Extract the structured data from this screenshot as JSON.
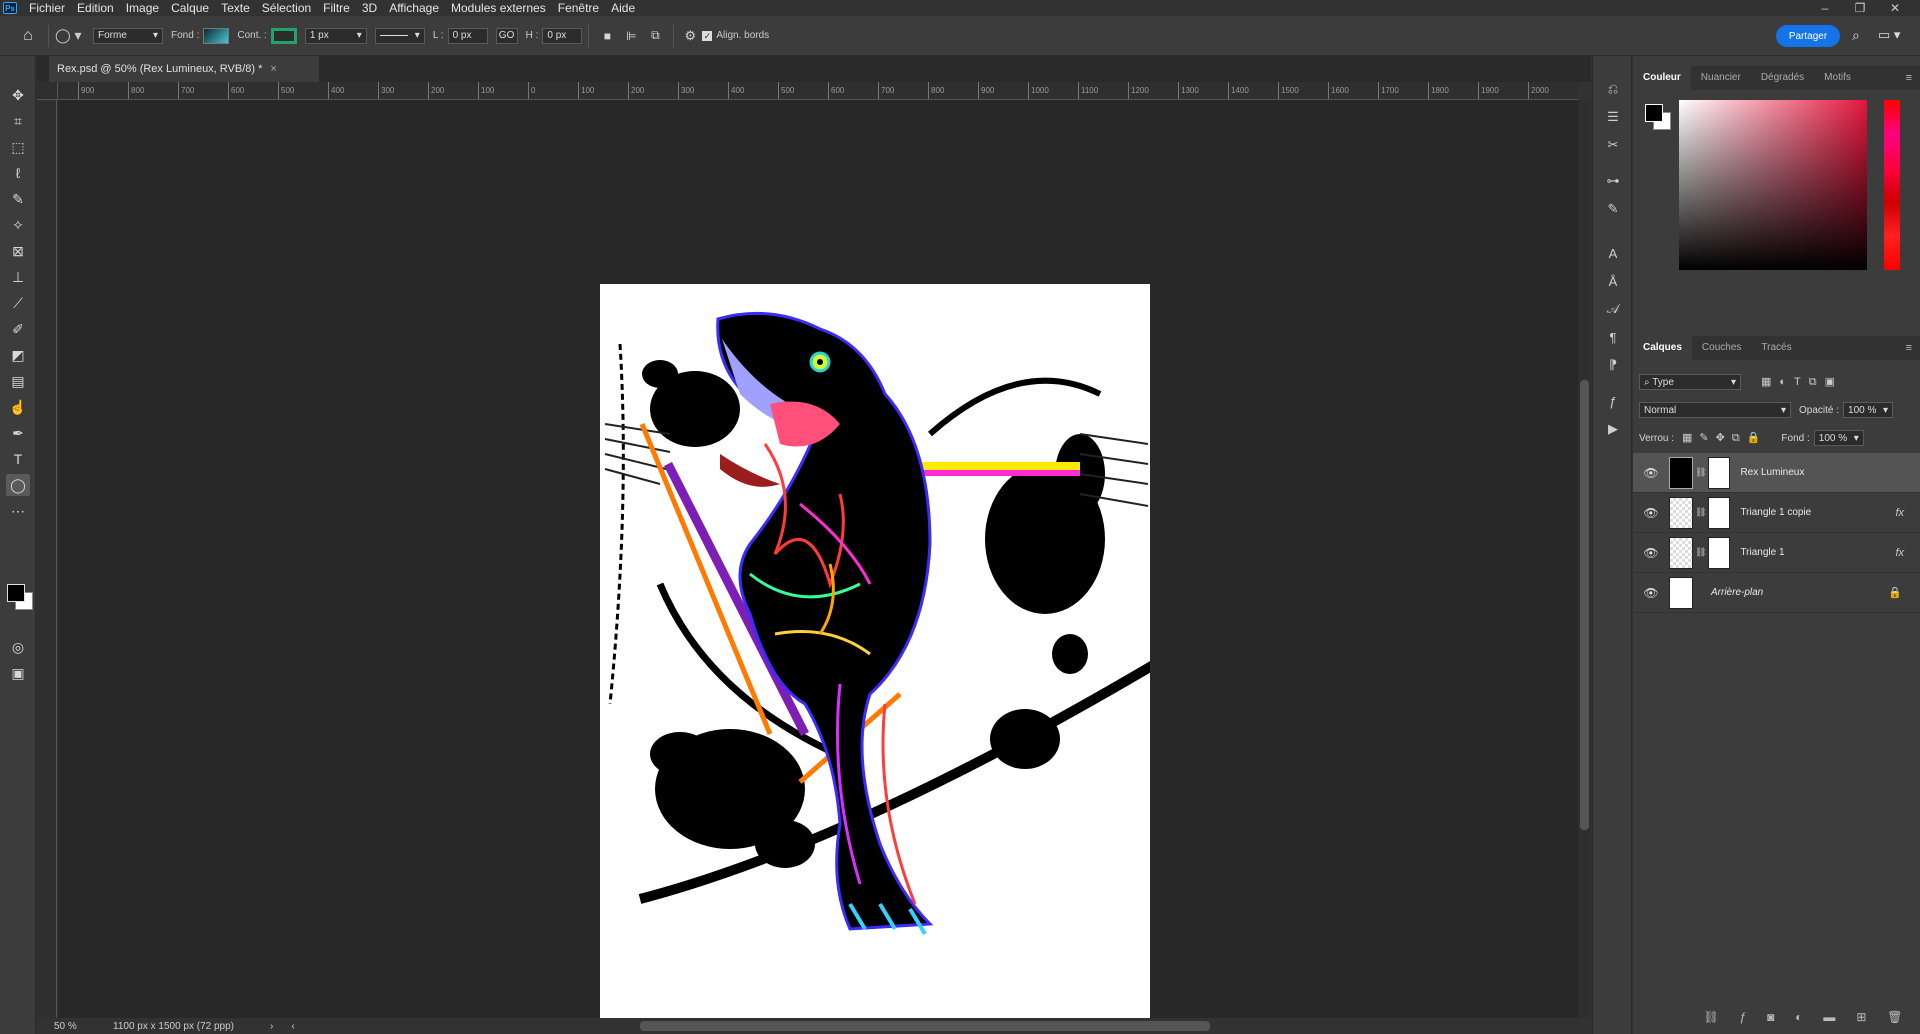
{
  "menu": [
    "Fichier",
    "Edition",
    "Image",
    "Calque",
    "Texte",
    "Sélection",
    "Filtre",
    "3D",
    "Affichage",
    "Modules externes",
    "Fenêtre",
    "Aide"
  ],
  "app_logo": "Ps",
  "window_controls": {
    "minimize": "–",
    "restore": "❐",
    "close": "✕"
  },
  "options": {
    "shape_mode": "Forme",
    "fill_label": "Fond :",
    "stroke_label": "Cont. :",
    "stroke_width": "1 px",
    "width_label": "L :",
    "width_value": "0 px",
    "link": "GO",
    "height_label": "H :",
    "height_value": "0 px",
    "align_edges": "Align. bords",
    "share": "Partager"
  },
  "document": {
    "tab_title": "Rex.psd @ 50% (Rex Lumineux, RVB/8) *",
    "tab_close": "×",
    "zoom": "50 %",
    "size_info": "1100 px x 1500 px (72 ppp)"
  },
  "ruler_h": [
    "900",
    "800",
    "700",
    "600",
    "500",
    "400",
    "300",
    "200",
    "100",
    "0",
    "100",
    "200",
    "300",
    "400",
    "500",
    "600",
    "700",
    "800",
    "900",
    "1000",
    "1100",
    "1200",
    "1300",
    "1400",
    "1500",
    "1600",
    "1700",
    "1800",
    "1900",
    "2000"
  ],
  "color_panel": {
    "tabs": [
      "Couleur",
      "Nuancier",
      "Dégradés",
      "Motifs"
    ],
    "fg": "#000000",
    "bg": "#ffffff",
    "hue": "#e4163c"
  },
  "layers_panel": {
    "tabs": [
      "Calques",
      "Couches",
      "Tracés"
    ],
    "filter": "Type",
    "blend_mode": "Normal",
    "opacity_label": "Opacité :",
    "opacity": "100 %",
    "lock_label": "Verrou :",
    "fill_label": "Fond :",
    "fill": "100 %",
    "layers": [
      {
        "name": "Rex Lumineux",
        "fx": ""
      },
      {
        "name": "Triangle 1 copie",
        "fx": "fx"
      },
      {
        "name": "Triangle 1",
        "fx": "fx"
      },
      {
        "name": "Arrière-plan",
        "fx": ""
      }
    ]
  }
}
